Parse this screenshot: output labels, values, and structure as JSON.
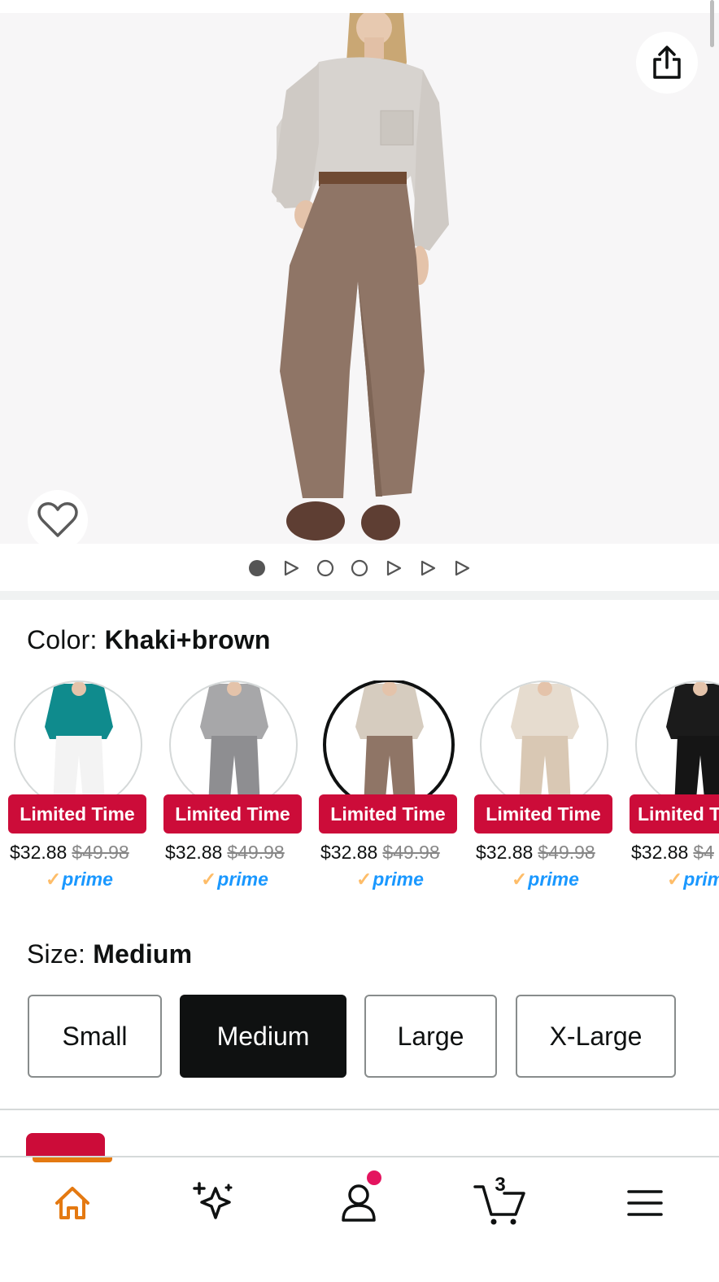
{
  "product": {
    "image_alt": "Woman wearing a beige knit sweater and khaki pants",
    "carousel": [
      "image",
      "video",
      "image",
      "image",
      "video",
      "video",
      "video"
    ],
    "active_index": 0
  },
  "color": {
    "label": "Color: ",
    "selected": "Khaki+brown",
    "options": [
      {
        "name": "Teal+white",
        "badge": "Limited Time",
        "price": "$32.88",
        "list_price": "$49.98",
        "prime": "prime",
        "top": "#0f8b8d",
        "bottom": "#f3f3f3"
      },
      {
        "name": "Grey",
        "badge": "Limited Time",
        "price": "$32.88",
        "list_price": "$49.98",
        "prime": "prime",
        "top": "#a7a7a9",
        "bottom": "#8e8e91"
      },
      {
        "name": "Khaki+brown",
        "badge": "Limited Time",
        "price": "$32.88",
        "list_price": "$49.98",
        "prime": "prime",
        "top": "#d6ccbf",
        "bottom": "#8f7566"
      },
      {
        "name": "Beige",
        "badge": "Limited Time",
        "price": "$32.88",
        "list_price": "$49.98",
        "prime": "prime",
        "top": "#e6dccf",
        "bottom": "#d9c8b4"
      },
      {
        "name": "Black",
        "badge": "Limited T",
        "price": "$32.88",
        "list_price": "$4",
        "prime": "prim",
        "top": "#1b1b1b",
        "bottom": "#151515"
      }
    ]
  },
  "size": {
    "label": "Size: ",
    "selected": "Medium",
    "options": [
      "Small",
      "Medium",
      "Large",
      "X-Large"
    ]
  },
  "nav": {
    "cart_count": "3",
    "items": [
      "home",
      "rufus",
      "account",
      "cart",
      "menu"
    ]
  },
  "colors": {
    "badge_red": "#cc0c39",
    "prime_blue": "#1a98ff",
    "nav_orange": "#e47911"
  }
}
